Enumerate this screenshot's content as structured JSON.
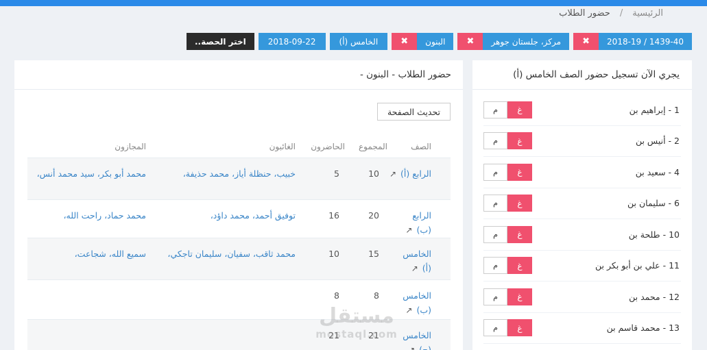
{
  "breadcrumb": {
    "home": "الرئيسية",
    "separator": "/",
    "current": "حضور الطلاب"
  },
  "filters": {
    "year": "1439-40 / 2018-19",
    "center": "مركز، جلستان جوهر",
    "gender": "البنون",
    "class": "الخامس (أ)",
    "date": "2018-09-22",
    "period_button": "اختر الحصة..",
    "remove_mark": "✖"
  },
  "attendance_card": {
    "title": "يجري الآن تسجيل حضور الصف الخامس (أ)",
    "present_label": "م",
    "absent_label": "غ",
    "students": [
      "1 - إبراهيم بن",
      "2 - أنيس بن",
      "4 - سعيد بن",
      "6 - سليمان بن",
      "10 - طلحة بن",
      "11 - علي بن أبو بكر بن",
      "12 - محمد بن",
      "13 - محمد قاسم بن"
    ]
  },
  "summary_card": {
    "title": "حضور الطلاب - البنون -",
    "refresh_label": "تحديث الصفحة",
    "columns": {
      "class": "الصف",
      "total": "المجموع",
      "present": "الحاضرون",
      "absent": "الغائبون",
      "excused": "المجازون"
    },
    "rows": [
      {
        "class": "الرابع (أ)",
        "total": "10",
        "present": "5",
        "absent": "خبيب، حنظلة أياز، محمد حذيفة،",
        "excused": "محمد أبو بكر، سيد محمد أنس،"
      },
      {
        "class": "الرابع (ب)",
        "total": "20",
        "present": "16",
        "absent": "توفيق أحمد، محمد داؤد،",
        "excused": "محمد حماد، راحت الله،"
      },
      {
        "class": "الخامس (أ)",
        "total": "15",
        "present": "10",
        "absent": "محمد ثاقب، سفيان، سليمان تاجكي،",
        "excused": "سميع الله، شجاعت،"
      },
      {
        "class": "الخامس (ب)",
        "total": "8",
        "present": "8",
        "absent": "",
        "excused": ""
      },
      {
        "class": "الخامس (ج)",
        "total": "21",
        "present": "21",
        "absent": "",
        "excused": ""
      }
    ]
  },
  "watermark": {
    "arabic": "مستقل",
    "latin": "mostaql.com"
  },
  "icons": {
    "external_link": "external-link-icon"
  },
  "colors": {
    "primary": "#3598dc",
    "danger": "#f0506e",
    "dark": "#2b2b2b",
    "link": "#3b86c8",
    "topbar": "#2b8ae8"
  }
}
